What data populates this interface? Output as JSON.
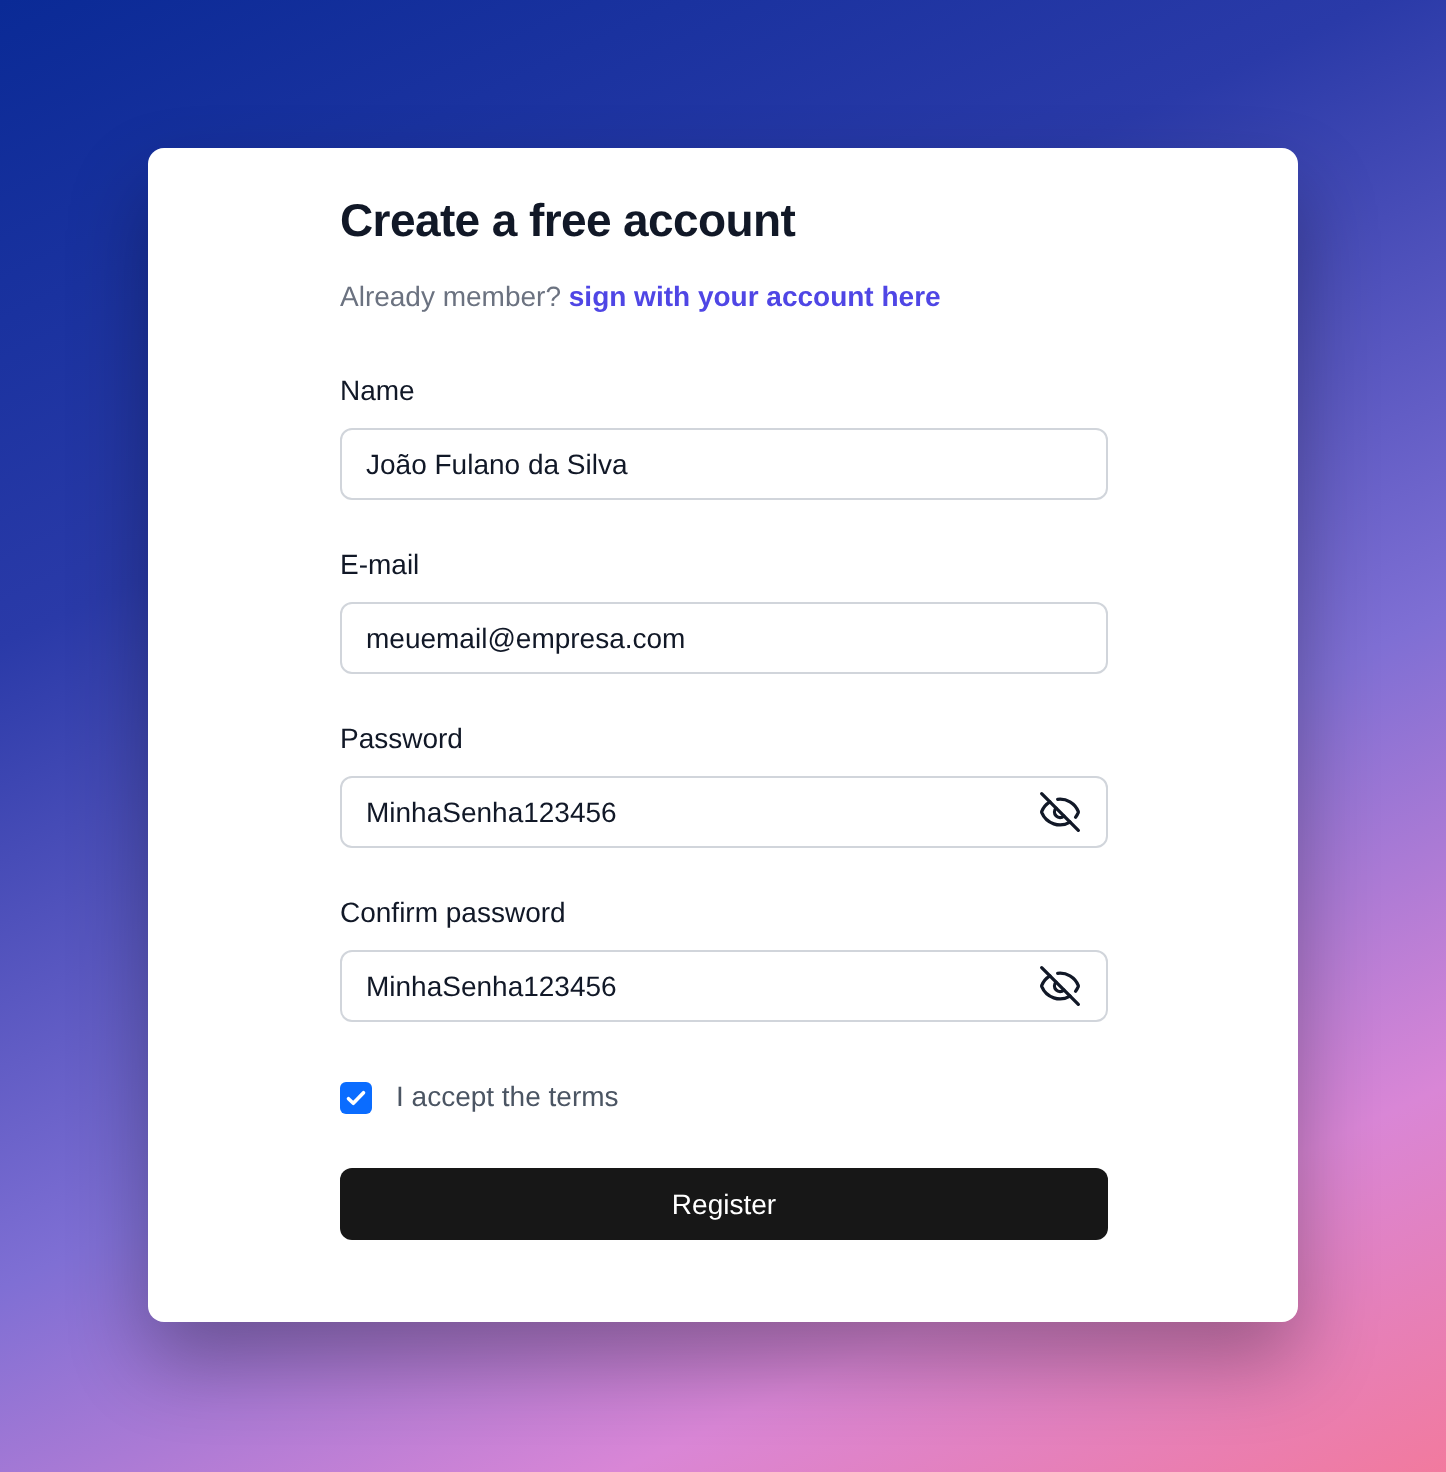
{
  "title": "Create a free account",
  "subtitle": {
    "text": "Already member?",
    "link": "sign with your account here"
  },
  "fields": [
    {
      "label": "Name",
      "value": "João Fulano da Silva",
      "kind": "text"
    },
    {
      "label": "E-mail",
      "value": "meuemail@empresa.com",
      "kind": "text"
    },
    {
      "label": "Password",
      "value": "MinhaSenha123456",
      "kind": "password",
      "show_password": true
    },
    {
      "label": "Confirm password",
      "value": "MinhaSenha123456",
      "kind": "password",
      "show_password": true
    }
  ],
  "terms": {
    "label": "I accept the terms",
    "checked": true
  },
  "button": "Register"
}
